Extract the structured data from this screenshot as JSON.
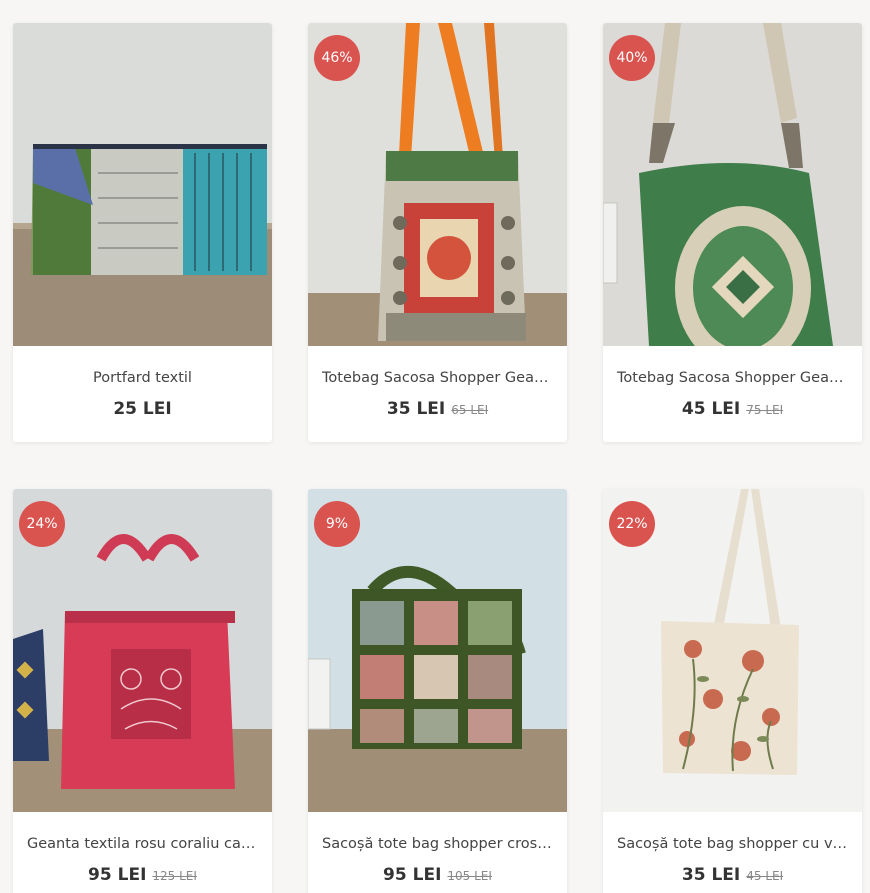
{
  "products": [
    {
      "title": "Portfard textil",
      "price": "25 LEI",
      "old_price": "",
      "badge": ""
    },
    {
      "title": "Totebag Sacosa Shopper Geant...",
      "price": "35 LEI",
      "old_price": "65 LEI",
      "badge": "46%"
    },
    {
      "title": "Totebag Sacosa Shopper Geant...",
      "price": "45 LEI",
      "old_price": "75 LEI",
      "badge": "40%"
    },
    {
      "title": "Geanta textila rosu coraliu capt...",
      "price": "95 LEI",
      "old_price": "125 LEI",
      "badge": "24%"
    },
    {
      "title": "Sacoșă tote bag shopper croset...",
      "price": "95 LEI",
      "old_price": "105 LEI",
      "badge": "9%"
    },
    {
      "title": "Sacoșă tote bag shopper cu vol...",
      "price": "35 LEI",
      "old_price": "45 LEI",
      "badge": "22%"
    }
  ],
  "colors": {
    "badge": "#d9534f",
    "page_background": "#f7f6f4",
    "card_background": "#ffffff"
  }
}
